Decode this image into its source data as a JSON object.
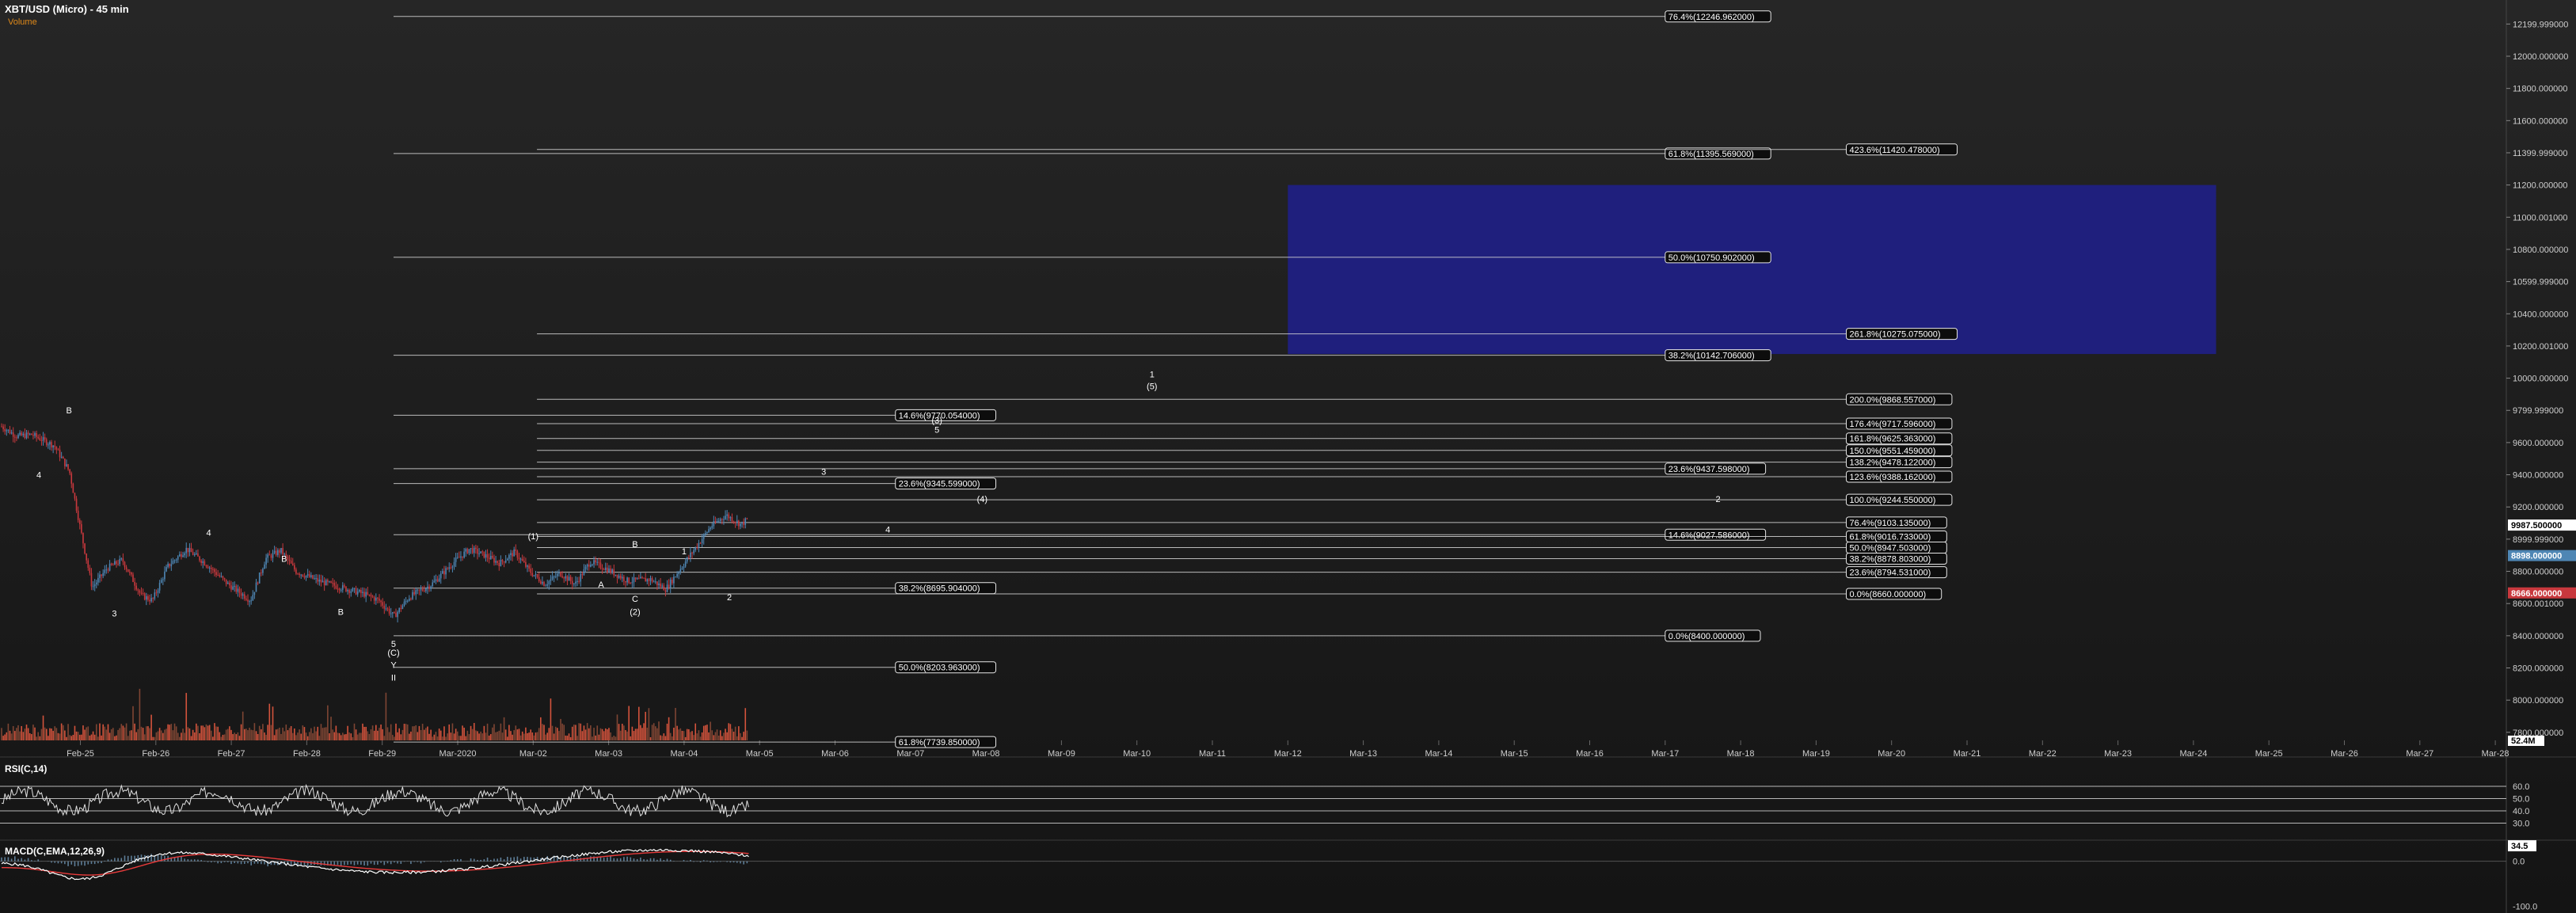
{
  "header": {
    "title": "XBT/USD (Micro) - 45 min",
    "subtitle": "Volume"
  },
  "colors": {
    "up": "#4e86b4",
    "down": "#c8383d",
    "fib": "#d6d6d6",
    "box": "#1f1f86",
    "rsi": "#e0e0e0",
    "macd": "#ffffff",
    "signal": "#e83b3b",
    "hist": "#6f97b8",
    "volume_up": "#8a4a36",
    "volume_down": "#e85a40",
    "volume_ma": "#d58a2b"
  },
  "chart_data": [
    {
      "type": "line",
      "title": "XBT/USD (Micro) - 45 min",
      "ylim": [
        7750,
        12300
      ],
      "y_ticks": [
        "12199.999000",
        "12000.000000",
        "11800.000000",
        "11600.000000",
        "11399.999000",
        "11200.000000",
        "11000.001000",
        "10800.000000",
        "10599.999000",
        "10400.000000",
        "10200.001000",
        "10000.000000",
        "9799.999000",
        "9600.000000",
        "9400.000000",
        "9200.000000",
        "8999.999000",
        "8800.000000",
        "8600.001000",
        "8400.000000",
        "8200.000000",
        "8000.000000",
        "7800.000000"
      ],
      "x_labels": [
        "Feb-25",
        "Feb-26",
        "Feb-27",
        "Feb-28",
        "Feb-29",
        "Mar-2020",
        "Mar-02",
        "Mar-03",
        "Mar-04",
        "Mar-05",
        "Mar-06",
        "Mar-07",
        "Mar-08",
        "Mar-09",
        "Mar-10",
        "Mar-11",
        "Mar-12",
        "Mar-13",
        "Mar-14",
        "Mar-15",
        "Mar-16",
        "Mar-17",
        "Mar-18",
        "Mar-19",
        "Mar-20",
        "Mar-21",
        "Mar-22",
        "Mar-23",
        "Mar-24",
        "Mar-25",
        "Mar-26",
        "Mar-27",
        "Mar-28"
      ],
      "price_path": [
        [
          0,
          9700
        ],
        [
          0.2,
          9640
        ],
        [
          0.4,
          9650
        ],
        [
          0.7,
          9580
        ],
        [
          0.9,
          9420
        ],
        [
          1.05,
          9050
        ],
        [
          1.2,
          8700
        ],
        [
          1.4,
          8820
        ],
        [
          1.6,
          8870
        ],
        [
          1.85,
          8650
        ],
        [
          2.0,
          8620
        ],
        [
          2.2,
          8830
        ],
        [
          2.45,
          8940
        ],
        [
          2.7,
          8850
        ],
        [
          3.0,
          8720
        ],
        [
          3.3,
          8620
        ],
        [
          3.5,
          8880
        ],
        [
          3.7,
          8930
        ],
        [
          3.9,
          8800
        ],
        [
          4.2,
          8740
        ],
        [
          4.5,
          8700
        ],
        [
          4.8,
          8660
        ],
        [
          5.0,
          8620
        ],
        [
          5.2,
          8520
        ],
        [
          5.4,
          8640
        ],
        [
          5.7,
          8720
        ],
        [
          6.0,
          8860
        ],
        [
          6.2,
          8940
        ],
        [
          6.4,
          8900
        ],
        [
          6.6,
          8850
        ],
        [
          6.8,
          8920
        ],
        [
          7.0,
          8800
        ],
        [
          7.2,
          8720
        ],
        [
          7.4,
          8790
        ],
        [
          7.6,
          8720
        ],
        [
          7.8,
          8860
        ],
        [
          8.0,
          8820
        ],
        [
          8.3,
          8740
        ],
        [
          8.6,
          8750
        ],
        [
          8.8,
          8690
        ],
        [
          9.0,
          8820
        ],
        [
          9.2,
          8950
        ],
        [
          9.4,
          9080
        ],
        [
          9.6,
          9150
        ],
        [
          9.8,
          9090
        ],
        [
          9.9,
          9130
        ]
      ],
      "price_labels": [
        {
          "value": "9987.500000",
          "bg": "#ffffff",
          "fg": "#000000",
          "price": 9087.5
        },
        {
          "value": "8898.000000",
          "bg": "#4e86b4",
          "fg": "#ffffff",
          "price": 8898
        },
        {
          "value": "8666.000000",
          "bg": "#c8383d",
          "fg": "#ffffff",
          "price": 8666
        }
      ],
      "fib_levels": [
        {
          "label": "76.4%(12246.962000)",
          "price": 12246.962,
          "x1": -0.85,
          "x2": 16.0,
          "lx": 16.0
        },
        {
          "label": "61.8%(11395.569000)",
          "price": 11395.569,
          "x1": -0.85,
          "x2": 16.0,
          "lx": 16.0
        },
        {
          "label": "423.6%(11420.478000)",
          "price": 11420.478,
          "x1": 1.05,
          "x2": 18.4,
          "lx": 18.4
        },
        {
          "label": "50.0%(10750.902000)",
          "price": 10750.902,
          "x1": -0.85,
          "x2": 16.0,
          "lx": 16.0
        },
        {
          "label": "261.8%(10275.075000)",
          "price": 10275.075,
          "x1": 1.05,
          "x2": 18.4,
          "lx": 18.4
        },
        {
          "label": "38.2%(10142.706000)",
          "price": 10142.706,
          "x1": -0.85,
          "x2": 16.0,
          "lx": 16.0
        },
        {
          "label": "200.0%(9868.557000)",
          "price": 9868.557,
          "x1": 1.05,
          "x2": 18.4,
          "lx": 18.4
        },
        {
          "label": "14.6%(9770.054000)",
          "price": 9770.054,
          "x1": -0.85,
          "x2": 5.8,
          "lx": 5.8
        },
        {
          "label": "176.4%(9717.596000)",
          "price": 9717.596,
          "x1": 1.05,
          "x2": 18.4,
          "lx": 18.4
        },
        {
          "label": "161.8%(9625.363000)",
          "price": 9625.363,
          "x1": 1.05,
          "x2": 18.4,
          "lx": 18.4
        },
        {
          "label": "150.0%(9551.459000)",
          "price": 9551.459,
          "x1": 1.05,
          "x2": 18.4,
          "lx": 18.4
        },
        {
          "label": "138.2%(9478.122000)",
          "price": 9478.122,
          "x1": 1.05,
          "x2": 18.4,
          "lx": 18.4
        },
        {
          "label": "23.6%(9437.598000)",
          "price": 9437.598,
          "x1": -0.85,
          "x2": 16.0,
          "lx": 16.0
        },
        {
          "label": "123.6%(9388.162000)",
          "price": 9388.162,
          "x1": 1.05,
          "x2": 18.4,
          "lx": 18.4
        },
        {
          "label": "23.6%(9345.599000)",
          "price": 9345.599,
          "x1": -0.85,
          "x2": 5.8,
          "lx": 5.8
        },
        {
          "label": "100.0%(9244.550000)",
          "price": 9244.55,
          "x1": 1.05,
          "x2": 18.4,
          "lx": 18.4
        },
        {
          "label": "76.4%(9103.135000)",
          "price": 9103.135,
          "x1": 1.05,
          "x2": 18.4,
          "lx": 18.4
        },
        {
          "label": "14.6%(9027.586000)",
          "price": 9027.586,
          "x1": -0.85,
          "x2": 16.0,
          "lx": 16.0
        },
        {
          "label": "61.8%(9016.733000)",
          "price": 9016.733,
          "x1": 1.05,
          "x2": 18.4,
          "lx": 18.4
        },
        {
          "label": "50.0%(8947.503000)",
          "price": 8947.503,
          "x1": 1.05,
          "x2": 18.4,
          "lx": 18.4
        },
        {
          "label": "38.2%(8878.803000)",
          "price": 8878.803,
          "x1": 1.05,
          "x2": 18.4,
          "lx": 18.4
        },
        {
          "label": "23.6%(8794.531000)",
          "price": 8794.531,
          "x1": 1.05,
          "x2": 18.4,
          "lx": 18.4
        },
        {
          "label": "38.2%(8695.904000)",
          "price": 8695.904,
          "x1": -0.85,
          "x2": 5.8,
          "lx": 5.8
        },
        {
          "label": "0.0%(8660.000000)",
          "price": 8660.0,
          "x1": 1.05,
          "x2": 18.4,
          "lx": 18.4
        },
        {
          "label": "0.0%(8400.000000)",
          "price": 8400.0,
          "x1": -0.85,
          "x2": 16.0,
          "lx": 16.0
        },
        {
          "label": "50.0%(8203.963000)",
          "price": 8203.963,
          "x1": -0.85,
          "x2": 5.8,
          "lx": 5.8
        },
        {
          "label": "61.8%(7739.850000)",
          "price": 7739.85,
          "x1": -0.85,
          "x2": 5.8,
          "lx": 5.8
        }
      ],
      "target_box": {
        "x1": 11.0,
        "x2": 23.3,
        "price_top": 11200,
        "price_bottom": 10150
      },
      "wave_labels": [
        {
          "text": "4",
          "x": -5.55,
          "price": 9400
        },
        {
          "text": "B",
          "x": -5.15,
          "price": 9800
        },
        {
          "text": "4",
          "x": -3.3,
          "price": 9040
        },
        {
          "text": "3",
          "x": -4.55,
          "price": 8540
        },
        {
          "text": "B",
          "x": -2.3,
          "price": 8880
        },
        {
          "text": "B",
          "x": -1.55,
          "price": 8550
        },
        {
          "text": "(1)",
          "x": 1.0,
          "price": 9020
        },
        {
          "text": "B",
          "x": 2.35,
          "price": 8970
        },
        {
          "text": "A",
          "x": 1.9,
          "price": 8720
        },
        {
          "text": "C",
          "x": 2.35,
          "price": 8630
        },
        {
          "text": "(2)",
          "x": 2.35,
          "price": 8550
        },
        {
          "text": "1",
          "x": 3.0,
          "price": 8925
        },
        {
          "text": "2",
          "x": 3.6,
          "price": 8640
        },
        {
          "text": "3",
          "x": 4.85,
          "price": 9420
        },
        {
          "text": "4",
          "x": 5.7,
          "price": 9060
        },
        {
          "text": "(3)",
          "x": 6.35,
          "price": 9740
        },
        {
          "text": "5",
          "x": 6.35,
          "price": 9680
        },
        {
          "text": "(4)",
          "x": 6.95,
          "price": 9250
        },
        {
          "text": "1",
          "x": 9.2,
          "price": 10025
        },
        {
          "text": "(5)",
          "x": 9.2,
          "price": 9950
        },
        {
          "text": "2",
          "x": 16.7,
          "price": 9250
        },
        {
          "text": "5",
          "x": -0.85,
          "price": 8350
        },
        {
          "text": "(C)",
          "x": -0.85,
          "price": 8295
        },
        {
          "text": "Y",
          "x": -0.85,
          "price": 8220
        },
        {
          "text": "II",
          "x": -0.85,
          "price": 8140
        }
      ]
    },
    {
      "type": "line",
      "title": "RSI(C,14)",
      "ylim": [
        20,
        80
      ],
      "y_ticks": [
        "60.0",
        "50.0",
        "40.0",
        "30.0"
      ],
      "levels": [
        60,
        50,
        40,
        30
      ]
    },
    {
      "type": "bar",
      "title": "MACD(C,EMA,12,26,9)",
      "ylim": [
        -110,
        40
      ],
      "y_ticks": [
        "0.0",
        "-100.0"
      ],
      "last_value": "34.5",
      "volume_last": "52.4M"
    }
  ]
}
